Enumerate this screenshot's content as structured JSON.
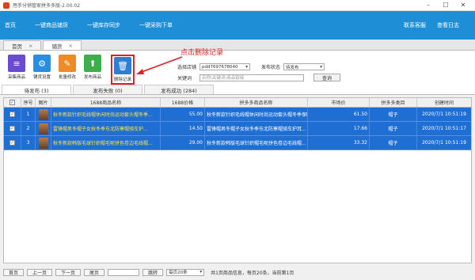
{
  "window": {
    "title": "甩手分销管家拼多多版-2.00.02"
  },
  "menu": {
    "items": [
      "首页",
      "一键商品铺货",
      "一键库存同步",
      "一键采购下单"
    ],
    "right": [
      "联系客服",
      "查看日志"
    ]
  },
  "tabs": [
    {
      "label": "首页"
    },
    {
      "label": "铺货"
    }
  ],
  "toolbar": {
    "collect": "采集商品",
    "settings": "铺货设置",
    "batch_edit": "批量修改",
    "publish": "发布商品",
    "delete": "删除记录"
  },
  "annotation": "点击删除记录",
  "filters": {
    "shop_label": "选择店铺",
    "shop_value": "pdd7697678040",
    "status_label": "发布状态",
    "status_value": "待发布",
    "keyword_label": "关键词",
    "keyword_placeholder": "名称\\关键词\\商品链接",
    "query": "查询"
  },
  "subtabs": [
    "待发布 (3)",
    "发布失败 (0)",
    "发布成功 (284)"
  ],
  "table": {
    "headers": [
      "序号",
      "图片",
      "1688商品名称",
      "1688价格",
      "拼多多商品名称",
      "市场价",
      "拼多多类目",
      "创建时间"
    ],
    "rows": [
      {
        "no": "1",
        "src_name": "秋冬新款针织毛线帽休闲时尚运动套头帽冬季...",
        "src_price": "55.00",
        "pdd_name": "秋冬新款针织毛线帽休闲时尚运动套头帽冬季保暖...",
        "market_price": "61.50",
        "category": "帽子",
        "time": "2020/7/1 10:51:19"
      },
      {
        "no": "2",
        "src_name": "雷锋帽男冬帽子女秋冬季东北防寒帽骑车护...",
        "src_price": "14.50",
        "pdd_name": "雷锋帽男冬帽子女秋冬季东北防寒帽骑车护耳...",
        "market_price": "17.66",
        "category": "帽子",
        "time": "2020/7/1 10:51:17"
      },
      {
        "no": "3",
        "src_name": "秋冬新款韩版毛球针织帽毛呢拼色卷边毛线帽...",
        "src_price": "29.00",
        "pdd_name": "秋冬新款韩版毛球针织帽毛呢拼色卷边毛线帽...",
        "market_price": "33.32",
        "category": "帽子",
        "time": "2020/7/1 10:51:19"
      }
    ]
  },
  "pager": {
    "first": "首页",
    "prev": "上一页",
    "next": "下一页",
    "last": "尾页",
    "jump": "跳转",
    "per_page": "每页20条",
    "info": "共1页商品信息，每页20条，当前第1页"
  }
}
